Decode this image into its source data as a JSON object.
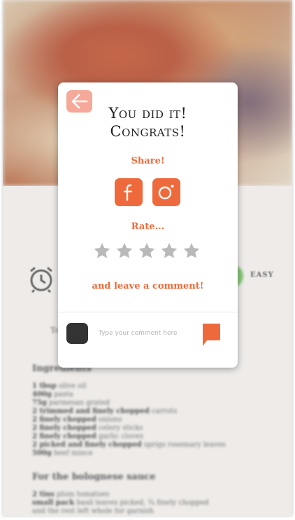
{
  "background": {
    "difficulty": "EASY",
    "to_snippet": "To",
    "ingredients_heading": "Ingredients",
    "ingredients": [
      {
        "qty": "1 tbsp",
        "item": "olive oil"
      },
      {
        "qty": "400g",
        "item": "pasta"
      },
      {
        "qty": "75g",
        "item": "parmesan grated"
      },
      {
        "qty": "2 trimmed and finely chopped",
        "item": "carrots"
      },
      {
        "qty": "2 finely chopped",
        "item": "onions"
      },
      {
        "qty": "2 finely chopped",
        "item": "celery sticks"
      },
      {
        "qty": "2 finely chopped",
        "item": "garlic cloves"
      },
      {
        "qty": "2 picked and finely chopped",
        "item": "sprigs rosemary leaves"
      },
      {
        "qty": "500g",
        "item": "beef mince"
      }
    ],
    "sauce_heading": "For the bolognese sauce",
    "sauce": [
      {
        "qty": "2 tins",
        "item": "plum tomatoes"
      },
      {
        "qty": "small pack",
        "item": "basil leaves picked, ¾ finely chopped"
      },
      {
        "qty": "",
        "item": "and the rest left whole for garnish"
      }
    ]
  },
  "modal": {
    "title_line1": "You did it!",
    "title_line2": "Congrats!",
    "share_label": "Share!",
    "rate_label": "Rate...",
    "rating": 0,
    "rating_max": 5,
    "comment_label": "and leave a comment!",
    "comment_placeholder": "Type your comment here",
    "comment_value": ""
  },
  "colors": {
    "accent": "#ee6a3c",
    "back_button": "#f6a999",
    "star_empty": "#b9b9b9",
    "avatar": "#333333"
  },
  "icons": {
    "back": "arrow-left-icon",
    "facebook": "facebook-icon",
    "instagram": "instagram-icon",
    "star": "star-icon",
    "send": "speech-bubble-icon",
    "clock": "alarm-clock-icon"
  }
}
